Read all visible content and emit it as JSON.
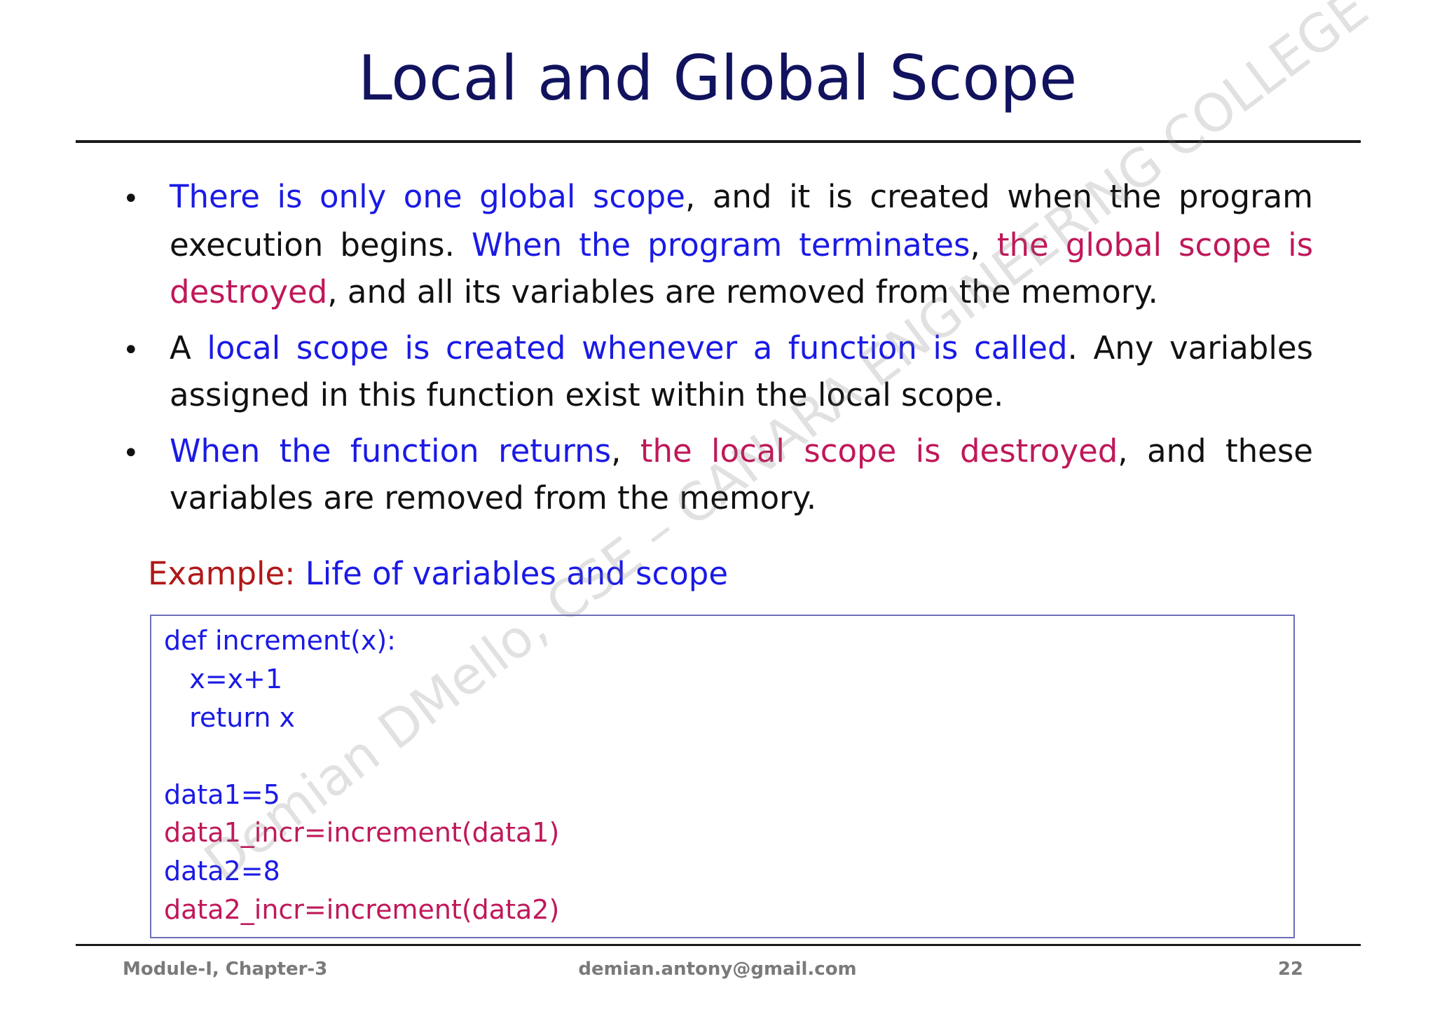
{
  "slide": {
    "title": "Local and Global Scope",
    "bullets": [
      {
        "lines": [
          [
            {
              "text": "There is only one global scope",
              "color": "blue"
            },
            {
              "text": ", and it is created when the program",
              "color": "ink"
            }
          ],
          [
            {
              "text": "execution begins. ",
              "color": "ink"
            },
            {
              "text": "When the program terminates",
              "color": "blue"
            },
            {
              "text": ", ",
              "color": "ink"
            },
            {
              "text": "the global scope is",
              "color": "red"
            }
          ],
          [
            {
              "text": "destroyed",
              "color": "red"
            },
            {
              "text": ", and all its variables are removed from the memory.",
              "color": "ink"
            }
          ]
        ]
      },
      {
        "lines": [
          [
            {
              "text": "A ",
              "color": "ink"
            },
            {
              "text": "local scope is created whenever a function is called",
              "color": "blue"
            },
            {
              "text": ". Any variables",
              "color": "ink"
            }
          ],
          [
            {
              "text": "assigned in this function exist within the local scope.",
              "color": "ink"
            }
          ]
        ]
      },
      {
        "lines": [
          [
            {
              "text": "When the function returns",
              "color": "blue"
            },
            {
              "text": ", ",
              "color": "ink"
            },
            {
              "text": "the local scope is destroyed",
              "color": "red"
            },
            {
              "text": ", and these",
              "color": "ink"
            }
          ],
          [
            {
              "text": "variables are removed from the memory.",
              "color": "ink"
            }
          ]
        ]
      }
    ],
    "example": {
      "label": "Example:",
      "description": " Life of variables and scope"
    },
    "code": [
      {
        "text": "def increment(x):",
        "color": "blue"
      },
      {
        "text": "   x=x+1",
        "color": "blue"
      },
      {
        "text": "   return x",
        "color": "blue"
      },
      {
        "text": "",
        "color": "blue"
      },
      {
        "text": "data1=5",
        "color": "blue"
      },
      {
        "text": "data1_incr=increment(data1)",
        "color": "red"
      },
      {
        "text": "data2=8",
        "color": "blue"
      },
      {
        "text": "data2_incr=increment(data2)",
        "color": "red"
      }
    ],
    "watermark": "Demian DMello, CSE – CANARA ENGINEERING COLLEGE",
    "footer": {
      "left": "Module-I, Chapter-3",
      "center": "demian.antony@gmail.com",
      "right": "22"
    },
    "colors": {
      "title": "#12135e",
      "blue": "#1a1ae6",
      "red": "#c0185a",
      "example_label": "#b01818",
      "text": "#111111"
    }
  }
}
